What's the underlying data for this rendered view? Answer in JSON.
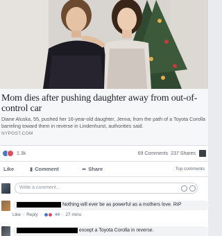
{
  "article": {
    "headline": "Mom dies after pushing daughter away from out-of-control car",
    "description": "Diane Aluska, 55, pushed her 16-year-old daughter, Jenna, from the path of a Toyota Corolla barreling toward them in reverse in Lindenhurst, authorities said.",
    "domain": "NYPOST.COM"
  },
  "reactions": {
    "count": "1.3k",
    "comments": "69 Comments",
    "shares": "237 Shares"
  },
  "actions": {
    "like": "Like",
    "comment": "Comment",
    "share": "Share",
    "sort": "Top comments"
  },
  "comment_box": {
    "placeholder": "Write a comment..."
  },
  "comments": [
    {
      "text": "Nothing will ever be as powerful as a mothers love. RIP",
      "like_label": "Like",
      "reply_label": "Reply",
      "reaction_count": "44",
      "time": "27 mins"
    },
    {
      "text": "except a Toyota Corolla in reverse."
    }
  ],
  "colors": {
    "facebook_blue": "#4267b2",
    "like_reaction": "#4a76c7",
    "love_reaction": "#e24b5b"
  }
}
